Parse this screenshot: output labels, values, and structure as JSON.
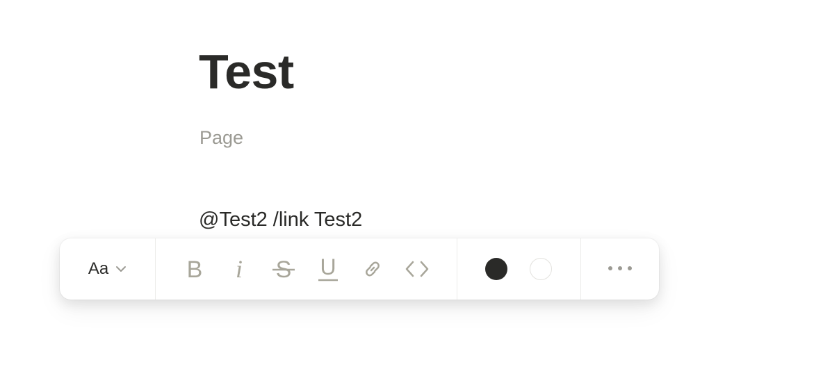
{
  "page": {
    "title": "Test",
    "subtitle": "Page",
    "body_text": "@Test2 /link Test2"
  },
  "toolbar": {
    "text_style_label": "Aa",
    "format_buttons": [
      {
        "icon": "bold-icon",
        "label": "B"
      },
      {
        "icon": "italic-icon",
        "label": "i"
      },
      {
        "icon": "strikethrough-icon",
        "label": "S"
      },
      {
        "icon": "underline-icon",
        "label": "U"
      },
      {
        "icon": "link-icon"
      },
      {
        "icon": "code-icon"
      }
    ],
    "colors": {
      "text_color": "#2a2a28",
      "background_color": "#ffffff"
    },
    "icon_color": "#a8a69a"
  }
}
